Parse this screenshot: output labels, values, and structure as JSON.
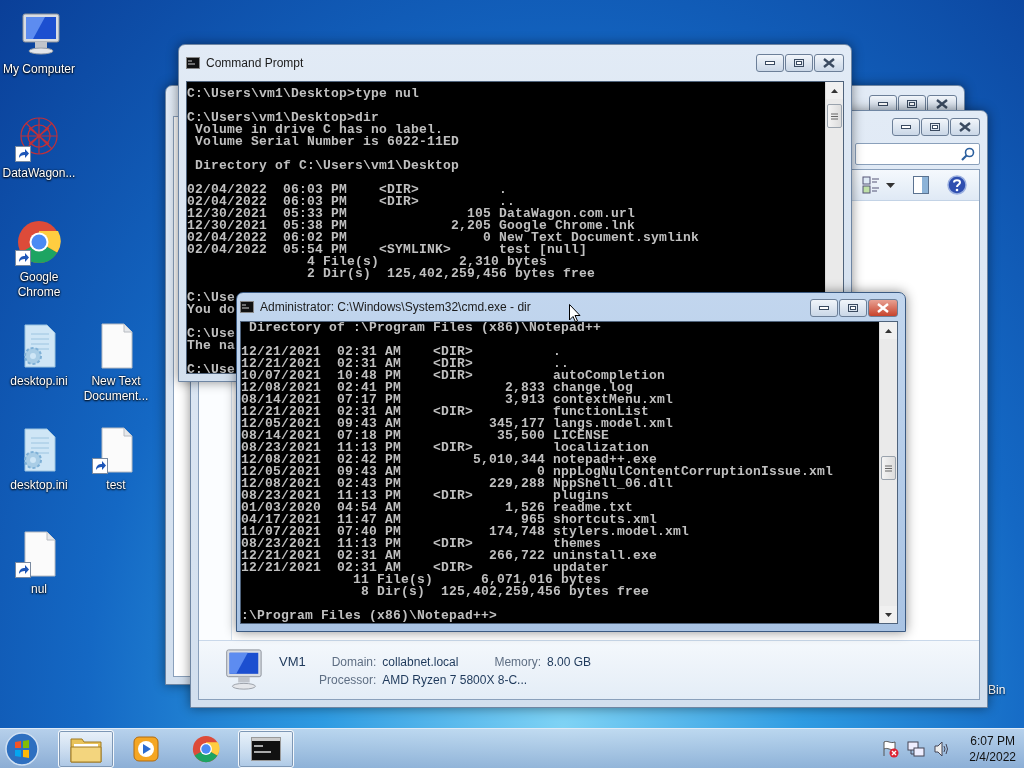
{
  "desktop_icons": [
    {
      "label": "My Computer",
      "kind": "computer",
      "shortcut": false
    },
    {
      "label": "DataWagon...",
      "kind": "web",
      "shortcut": true
    },
    {
      "label": "Google Chrome",
      "kind": "chrome",
      "shortcut": true
    },
    {
      "label": "desktop.ini",
      "kind": "settings-file",
      "shortcut": false
    },
    {
      "label": "New Text Document...",
      "kind": "document",
      "shortcut": false
    },
    {
      "label": "desktop.ini",
      "kind": "settings-file",
      "shortcut": false
    },
    {
      "label": "test",
      "kind": "document",
      "shortcut": true
    },
    {
      "label": "nul",
      "kind": "document",
      "shortcut": true
    }
  ],
  "recycle_bin_label": "Bin",
  "explorer_window": {
    "details": {
      "name": "VM1",
      "fields": [
        {
          "label": "Domain:",
          "value": "collabnet.local"
        },
        {
          "label": "Memory:",
          "value": "8.00 GB"
        },
        {
          "label": "Processor:",
          "value": "AMD Ryzen 7 5800X 8-C..."
        }
      ]
    }
  },
  "command_windows": [
    {
      "title": "Command Prompt",
      "active": false,
      "blocks": [
        [
          "C:\\Users\\vm1\\Desktop>type nul"
        ],
        [
          "C:\\Users\\vm1\\Desktop>dir",
          " Volume in drive C has no label.",
          " Volume Serial Number is 6022-11ED"
        ],
        [
          " Directory of C:\\Users\\vm1\\Desktop"
        ],
        [
          "02/04/2022  06:03 PM    <DIR>          .",
          "02/04/2022  06:03 PM    <DIR>          ..",
          "12/30/2021  05:33 PM               105 DataWagon.com.url",
          "12/30/2021  05:38 PM             2,205 Google Chrome.lnk",
          "02/04/2022  06:02 PM                 0 New Text Document.symlink",
          "02/04/2022  05:54 PM    <SYMLINK>      test [null]",
          "               4 File(s)          2,310 bytes",
          "               2 Dir(s)  125,402,259,456 bytes free"
        ],
        [
          "C:\\Use",
          "You do"
        ],
        [
          "C:\\Use",
          "The na"
        ],
        [
          "C:\\Use"
        ]
      ]
    },
    {
      "title": "Administrator: C:\\Windows\\System32\\cmd.exe - dir",
      "active": true,
      "blocks": [
        [
          " Directory of :\\Program Files (x86)\\Notepad++"
        ],
        [
          "12/21/2021  02:31 AM    <DIR>          .",
          "12/21/2021  02:31 AM    <DIR>          ..",
          "10/07/2021  10:48 PM    <DIR>          autoCompletion",
          "12/08/2021  02:41 PM             2,833 change.log",
          "08/14/2021  07:17 PM             3,913 contextMenu.xml",
          "12/21/2021  02:31 AM    <DIR>          functionList",
          "12/05/2021  09:43 AM           345,177 langs.model.xml",
          "08/14/2021  07:18 PM            35,500 LICENSE",
          "08/23/2021  11:13 PM    <DIR>          localization",
          "12/08/2021  02:42 PM         5,010,344 notepad++.exe",
          "12/05/2021  09:43 AM                 0 nppLogNulContentCorruptionIssue.xml",
          "12/08/2021  02:43 PM           229,288 NppShell_06.dll",
          "08/23/2021  11:13 PM    <DIR>          plugins",
          "01/03/2020  04:54 AM             1,526 readme.txt",
          "04/17/2021  11:47 AM               965 shortcuts.xml",
          "11/07/2021  07:40 PM           174,748 stylers.model.xml",
          "08/23/2021  11:13 PM    <DIR>          themes",
          "12/21/2021  02:31 AM           266,722 uninstall.exe",
          "12/21/2021  02:31 AM    <DIR>          updater",
          "              11 File(s)      6,071,016 bytes",
          "               8 Dir(s)  125,402,259,456 bytes free"
        ],
        [
          ":\\Program Files (x86)\\Notepad++>"
        ]
      ]
    }
  ],
  "taskbar": {
    "apps": [
      {
        "kind": "explorer",
        "running": true
      },
      {
        "kind": "media",
        "running": false
      },
      {
        "kind": "chrome",
        "running": false
      },
      {
        "kind": "console",
        "running": true
      }
    ],
    "tray": {
      "time": "6:07 PM",
      "date": "2/4/2022"
    }
  }
}
